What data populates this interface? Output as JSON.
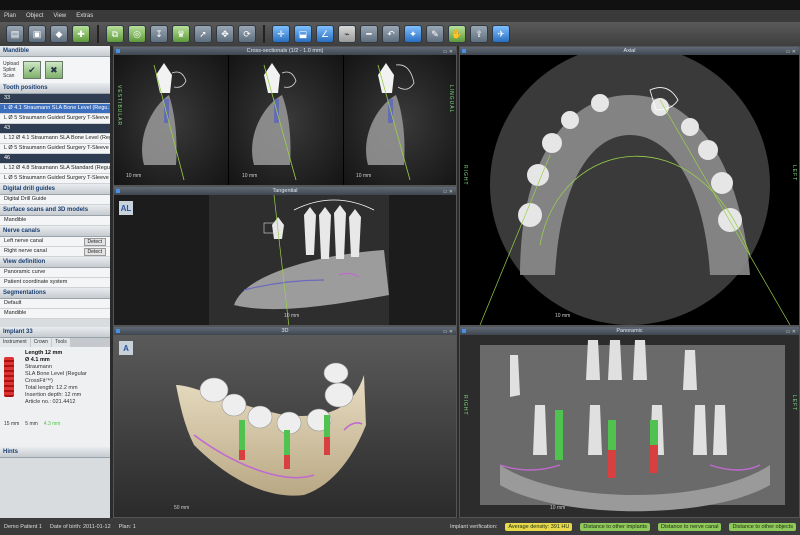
{
  "menu": [
    "Plan",
    "Object",
    "View",
    "Extras"
  ],
  "toolbar": {
    "icons": [
      "open-folder-icon",
      "save-icon",
      "cube-icon",
      "implant-add-icon",
      "implant-copy-icon",
      "sleeve-icon",
      "drill-icon",
      "crown-icon",
      "arrow-icon",
      "move-icon",
      "rotate-icon",
      "select-icon",
      "measure-icon",
      "angle-icon",
      "nerve-icon",
      "ruler-icon",
      "undo-icon",
      "wand-icon",
      "pen-icon",
      "hand-icon",
      "export-icon"
    ]
  },
  "left_panel": {
    "mandible_title": "Mandible",
    "mandible_options": [
      "Upload",
      "Splint",
      "Scan"
    ],
    "tooth_positions_title": "Tooth positions",
    "tooth_groups": [
      {
        "number": "33",
        "rows": [
          "L  Ø 4.1  Straumann SLA Bone Level (Regu…",
          "L  Ø 5  Straumann Guided Surgery T-Sleeve"
        ]
      },
      {
        "number": "43",
        "rows": [
          "L  12  Ø 4.1  Straumann SLA Bone Level (Regu…",
          "L  Ø 5  Straumann Guided Surgery T-Sleeve"
        ]
      },
      {
        "number": "46",
        "rows": [
          "L  12  Ø 4.8  Straumann SLA Standard (Regula…",
          "L  Ø 5  Straumann Guided Surgery T-Sleeve"
        ]
      }
    ],
    "drill_guides_title": "Digital drill guides",
    "drill_guides_item": "Digital Drill Guide",
    "surface_scans_title": "Surface scans and 3D models",
    "surface_scans_item": "Mandible",
    "nerve_canals_title": "Nerve canals",
    "nerve_left": "Left nerve canal",
    "nerve_right": "Right nerve canal",
    "detect_label": "Detect",
    "view_definition_title": "View definition",
    "view_def_items": [
      "Panoramic curve",
      "Patient coordinate system"
    ],
    "segmentations_title": "Segmentations",
    "segmentation_items": [
      "Default",
      "Mandible"
    ],
    "implant_tab": "Implant 33",
    "info_tabs": [
      "Instrument",
      "Crown",
      "Tools"
    ],
    "implant_info": {
      "length": "Length 12 mm",
      "diameter": "Ø 4.1 mm",
      "brand": "Straumann",
      "model": "SLA Bone Level (Regular CrossFit™)",
      "total_length": "Total length: 12.2 mm",
      "insertion": "Insertion depth: 12 mm",
      "article": "Article no.: 021.4412"
    },
    "measure_1": "4.3 mm",
    "measure_2": "15 mm",
    "measure_3": "5 mm",
    "bottom_label": "Hints"
  },
  "viewports": {
    "cross": {
      "title": "Cross-sectionals (1/2 - 1.0 mm)",
      "scale": "10 mm",
      "side_a": "VESTIBULAR",
      "side_b": "LINGUAL"
    },
    "axial": {
      "title": "Axial",
      "scale": "10 mm",
      "side_right": "RIGHT",
      "side_left": "LEFT"
    },
    "tangential": {
      "title": "Tangential",
      "scale": "10 mm"
    },
    "three_d": {
      "title": "3D",
      "scale": "50 mm"
    },
    "panoramic": {
      "title": "Panoramic",
      "scale": "10 mm",
      "side_right": "RIGHT",
      "side_left": "LEFT"
    }
  },
  "status": {
    "patient": "Demo Patient 1",
    "dob": "Date of birth: 2011-01-12",
    "plan": "Plan: 1",
    "verification": "Implant verification:",
    "density": "Average density: 391 HU",
    "pill1": "Distance to other implants",
    "pill2": "Distance to nerve canal",
    "pill3": "Distance to other objects"
  },
  "colors": {
    "accent": "#3d6fbf",
    "implant_green": "#4fc24f",
    "implant_red": "#d84040",
    "nerve_pink": "#c06ad0",
    "status_green": "#8fc95a",
    "status_yellow": "#e8d94a"
  }
}
